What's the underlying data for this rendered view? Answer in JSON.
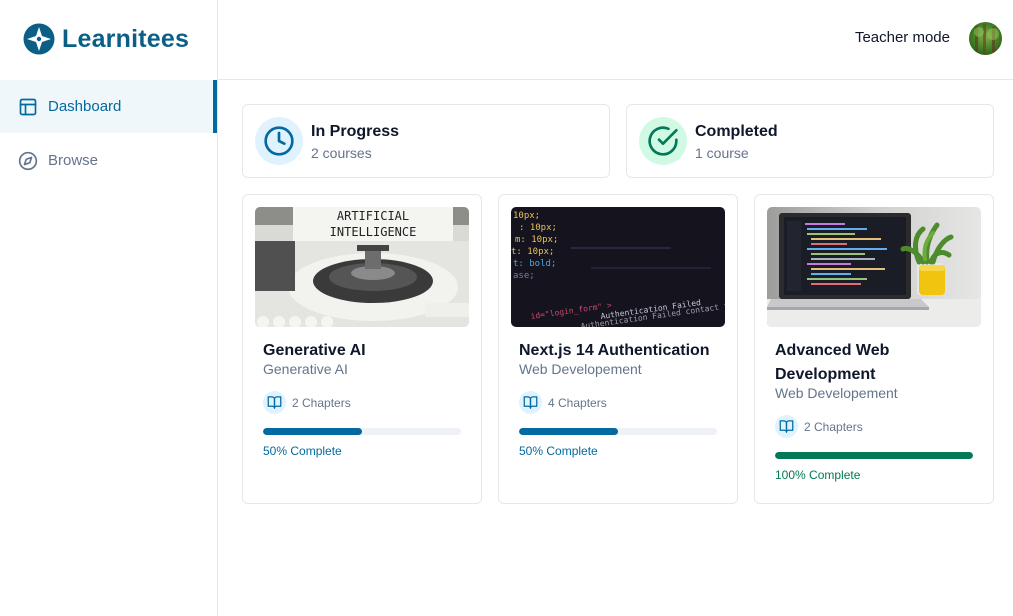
{
  "brand": {
    "name": "Learnitees",
    "color": "#0b5f87"
  },
  "sidebar": {
    "items": [
      {
        "label": "Dashboard",
        "icon": "layout-icon",
        "active": true
      },
      {
        "label": "Browse",
        "icon": "compass-icon",
        "active": false
      }
    ]
  },
  "header": {
    "teacher_mode_label": "Teacher mode"
  },
  "stats": {
    "in_progress": {
      "title": "In Progress",
      "subtitle": "2 courses",
      "icon": "clock-icon",
      "color": "#0369a1"
    },
    "completed": {
      "title": "Completed",
      "subtitle": "1 course",
      "icon": "check-circle-icon",
      "color": "#047857"
    }
  },
  "courses": [
    {
      "title": "Generative AI",
      "category": "Generative AI",
      "chapters": "2 Chapters",
      "progress": 50,
      "progress_label": "50% Complete",
      "thumbnail_text": "ARTIFICIAL INTELLIGENCE",
      "color": "#0369a1"
    },
    {
      "title": "Next.js 14 Authentication",
      "category": "Web Developement",
      "chapters": "4 Chapters",
      "progress": 50,
      "progress_label": "50% Complete",
      "color": "#0369a1"
    },
    {
      "title": "Advanced Web Development",
      "category": "Web Developement",
      "chapters": "2 Chapters",
      "progress": 100,
      "progress_label": "100% Complete",
      "color": "#047857"
    }
  ]
}
